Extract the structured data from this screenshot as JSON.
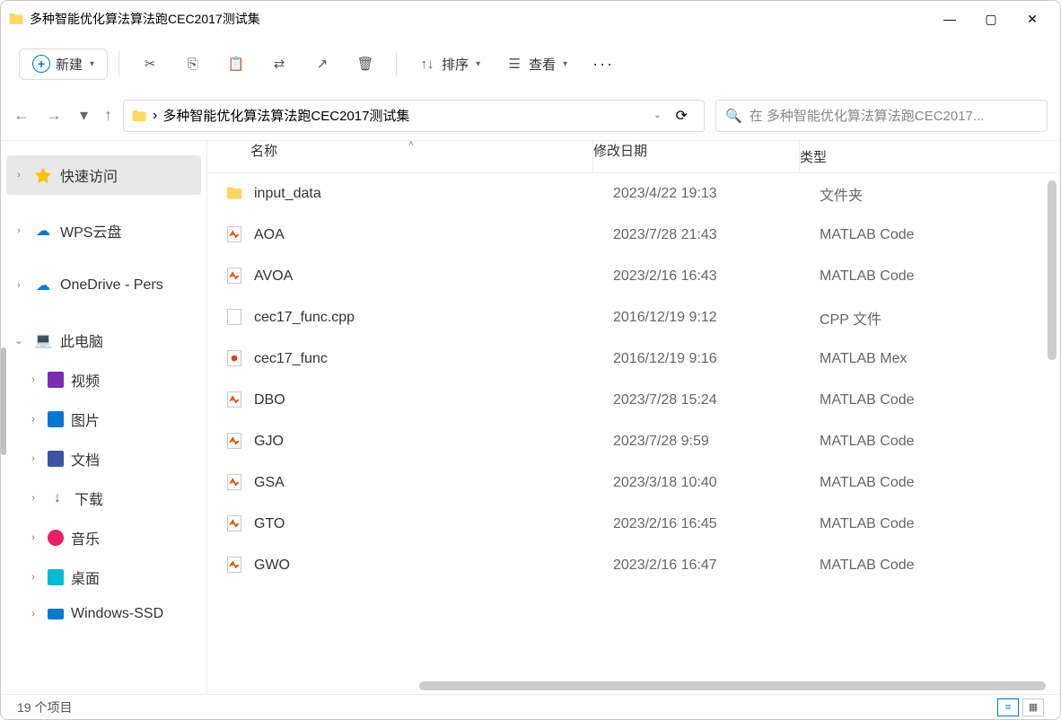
{
  "window": {
    "title": "多种智能优化算法算法跑CEC2017测试集"
  },
  "toolbar": {
    "new_label": "新建",
    "sort_label": "排序",
    "view_label": "查看"
  },
  "addressbar": {
    "path": "多种智能优化算法算法跑CEC2017测试集",
    "search_placeholder": "在 多种智能优化算法算法跑CEC2017..."
  },
  "sidebar": {
    "quick_access": "快速访问",
    "wps": "WPS云盘",
    "onedrive": "OneDrive - Pers",
    "this_pc": "此电脑",
    "videos": "视频",
    "pictures": "图片",
    "documents": "文档",
    "downloads": "下载",
    "music": "音乐",
    "desktop": "桌面",
    "windows_ssd": "Windows-SSD"
  },
  "columns": {
    "name": "名称",
    "date": "修改日期",
    "type": "类型"
  },
  "files": [
    {
      "name": "input_data",
      "date": "2023/4/22 19:13",
      "type": "文件夹",
      "icon": "folder"
    },
    {
      "name": "AOA",
      "date": "2023/7/28 21:43",
      "type": "MATLAB Code",
      "icon": "matlab"
    },
    {
      "name": "AVOA",
      "date": "2023/2/16 16:43",
      "type": "MATLAB Code",
      "icon": "matlab"
    },
    {
      "name": "cec17_func.cpp",
      "date": "2016/12/19 9:12",
      "type": "CPP 文件",
      "icon": "cpp"
    },
    {
      "name": "cec17_func",
      "date": "2016/12/19 9:16",
      "type": "MATLAB Mex",
      "icon": "mex"
    },
    {
      "name": "DBO",
      "date": "2023/7/28 15:24",
      "type": "MATLAB Code",
      "icon": "matlab"
    },
    {
      "name": "GJO",
      "date": "2023/7/28 9:59",
      "type": "MATLAB Code",
      "icon": "matlab"
    },
    {
      "name": "GSA",
      "date": "2023/3/18 10:40",
      "type": "MATLAB Code",
      "icon": "matlab"
    },
    {
      "name": "GTO",
      "date": "2023/2/16 16:45",
      "type": "MATLAB Code",
      "icon": "matlab"
    },
    {
      "name": "GWO",
      "date": "2023/2/16 16:47",
      "type": "MATLAB Code",
      "icon": "matlab"
    }
  ],
  "statusbar": {
    "item_count": "19 个项目"
  }
}
